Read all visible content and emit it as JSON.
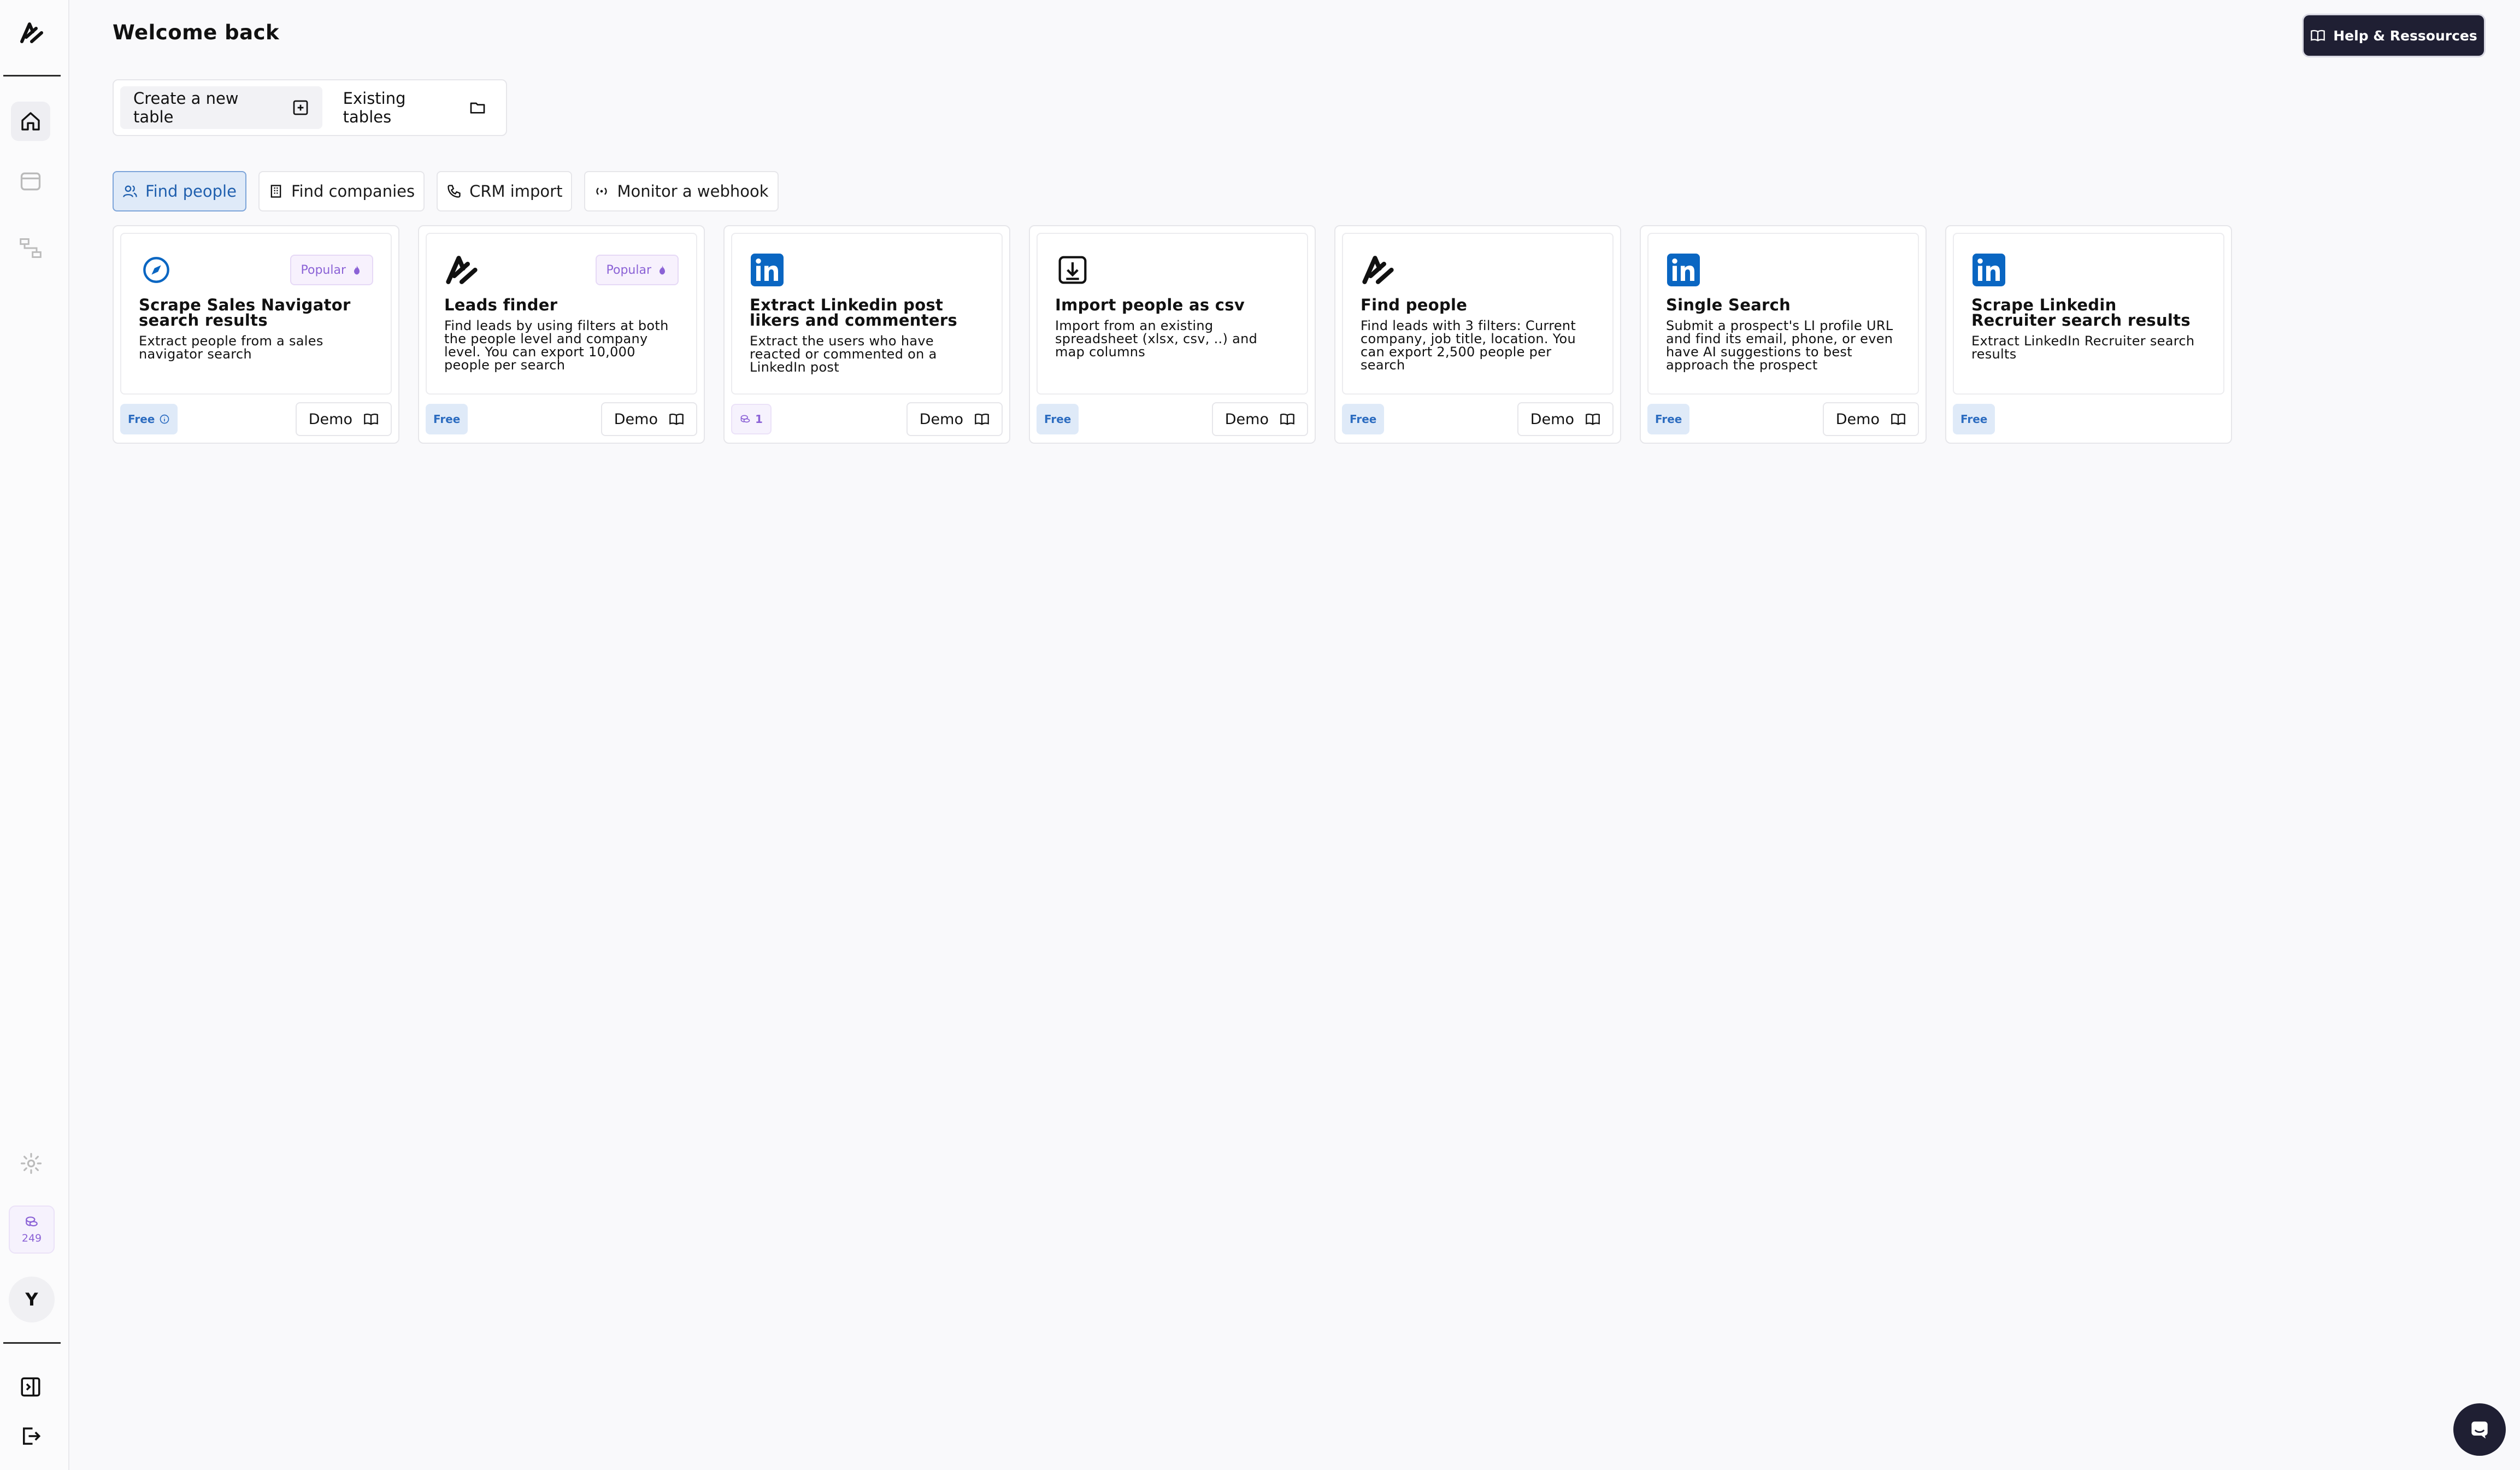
{
  "header": {
    "title": "Welcome back",
    "help_label": "Help & Ressources"
  },
  "sidebar": {
    "items": [
      {
        "name": "logo-icon"
      },
      {
        "name": "home-icon",
        "active": true
      },
      {
        "name": "tables-icon"
      },
      {
        "name": "workflows-icon"
      },
      {
        "name": "settings-icon"
      }
    ],
    "credits": "249",
    "avatar_initial": "Y"
  },
  "table_actions": {
    "create_label": "Create a new table",
    "existing_label": "Existing tables"
  },
  "tabs": [
    {
      "label": "Find people",
      "active": true,
      "icon": "users-icon"
    },
    {
      "label": "Find companies",
      "active": false,
      "icon": "building-icon"
    },
    {
      "label": "CRM import",
      "active": false,
      "icon": "phone-icon"
    },
    {
      "label": "Monitor a webhook",
      "active": false,
      "icon": "webhook-icon"
    }
  ],
  "cards": [
    {
      "logo": "compass-icon",
      "popular": "Popular",
      "title": "Scrape Sales Navigator search results",
      "desc": "Extract people from a sales navigator search",
      "badge": "Free",
      "badge_info": true,
      "demo": "Demo"
    },
    {
      "logo": "brand-logo-icon",
      "popular": "Popular",
      "title": "Leads finder",
      "desc": "Find leads by using filters at both the people level and company level. You can export 10,000 people per search",
      "badge": "Free",
      "demo": "Demo"
    },
    {
      "logo": "linkedin-icon",
      "title": "Extract Linkedin post likers and commenters",
      "desc": "Extract the users who have reacted or commented on a LinkedIn post",
      "badge": "1",
      "badge_credit": true,
      "demo": "Demo"
    },
    {
      "logo": "download-icon",
      "title": "Import people as csv",
      "desc": "Import from an existing spreadsheet (xlsx, csv, ..) and map columns",
      "badge": "Free",
      "demo": "Demo"
    },
    {
      "logo": "brand-logo-icon",
      "title": "Find people",
      "desc": "Find leads with 3 filters: Current company, job title, location. You can export 2,500 people per search",
      "badge": "Free",
      "demo": "Demo"
    },
    {
      "logo": "linkedin-icon",
      "title": "Single Search",
      "desc": "Submit a prospect's LI profile URL and find its email, phone, or even have AI suggestions to best approach the prospect",
      "badge": "Free",
      "demo": "Demo"
    },
    {
      "logo": "linkedin-icon",
      "title": "Scrape Linkedin Recruiter search results",
      "desc": "Extract LinkedIn Recruiter search results",
      "badge": "Free"
    }
  ],
  "colors": {
    "accent_blue": "#2c6cc0",
    "dark": "#1f1f33",
    "purple": "#8b62d6",
    "linkedin": "#0a66c2"
  }
}
